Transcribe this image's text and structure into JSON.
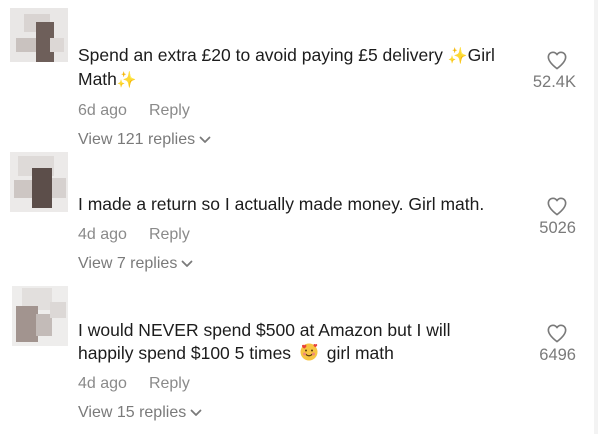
{
  "comments": [
    {
      "text_part1": "Spend an extra £20 to avoid paying £5 delivery ",
      "sparkle_icon": "✨",
      "text_part2": "Girl",
      "text_line2": "Math",
      "time": "6d ago",
      "reply_label": "Reply",
      "view_replies": "View 121 replies",
      "likes": "52.4K"
    },
    {
      "text": "I made a return so I actually made money. Girl math.",
      "time": "4d ago",
      "reply_label": "Reply",
      "view_replies": "View 7 replies",
      "likes": "5026"
    },
    {
      "text_line1": "I would NEVER spend $500 at Amazon but I will",
      "text_line2a": "happily spend $100 5 times ",
      "emoji_icon": "smiling-face-with-hearts-icon",
      "text_line2b": " girl math",
      "time": "4d ago",
      "reply_label": "Reply",
      "view_replies": "View 15 replies",
      "likes": "6496"
    }
  ],
  "colors": {
    "text": "#1c1c1c",
    "muted": "#8a8a8a",
    "sparkle": "#f2cf52"
  }
}
